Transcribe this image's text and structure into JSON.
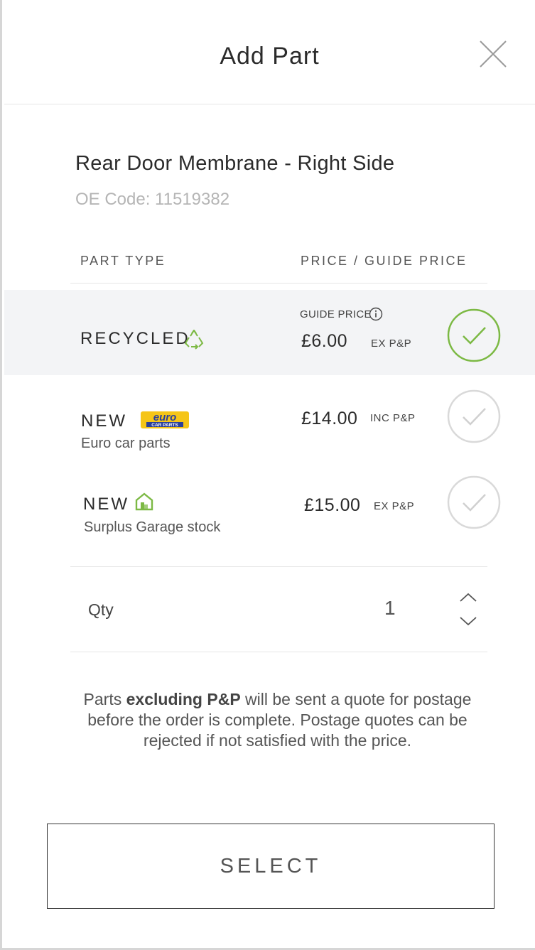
{
  "header": {
    "title": "Add Part",
    "close_icon": "close-icon"
  },
  "part": {
    "name": "Rear Door Membrane - Right Side",
    "oe_code": "OE Code: 11519382"
  },
  "columns": {
    "type": "PART TYPE",
    "price": "PRICE / GUIDE PRICE"
  },
  "options": [
    {
      "type": "RECYCLED",
      "subtitle": "",
      "guide_label": "GUIDE PRICE",
      "price": "£6.00",
      "pp": "EX P&P",
      "selected": true,
      "icon": "recycle-icon"
    },
    {
      "type": "NEW",
      "subtitle": "Euro car parts",
      "logo_text": "euro",
      "logo_subtext": "CAR PARTS",
      "price": "£14.00",
      "pp": "INC P&P",
      "selected": false,
      "icon": "euro-car-parts-logo"
    },
    {
      "type": "NEW",
      "subtitle": "Surplus Garage stock",
      "price": "£15.00",
      "pp": "EX P&P",
      "selected": false,
      "icon": "garage-icon"
    }
  ],
  "quantity": {
    "label": "Qty",
    "value": "1"
  },
  "note": {
    "prefix": "Parts ",
    "bold": "excluding P&P",
    "suffix": " will be sent a quote for postage before the order is complete. Postage quotes can be rejected if not satisfied with the price."
  },
  "select_button": "SELECT",
  "colors": {
    "accent_green": "#7cb944",
    "unselected_circle": "#d9d9d9",
    "selected_row_bg": "#f3f4f6",
    "euro_yellow": "#f5c518",
    "euro_blue": "#2a3f9a"
  }
}
